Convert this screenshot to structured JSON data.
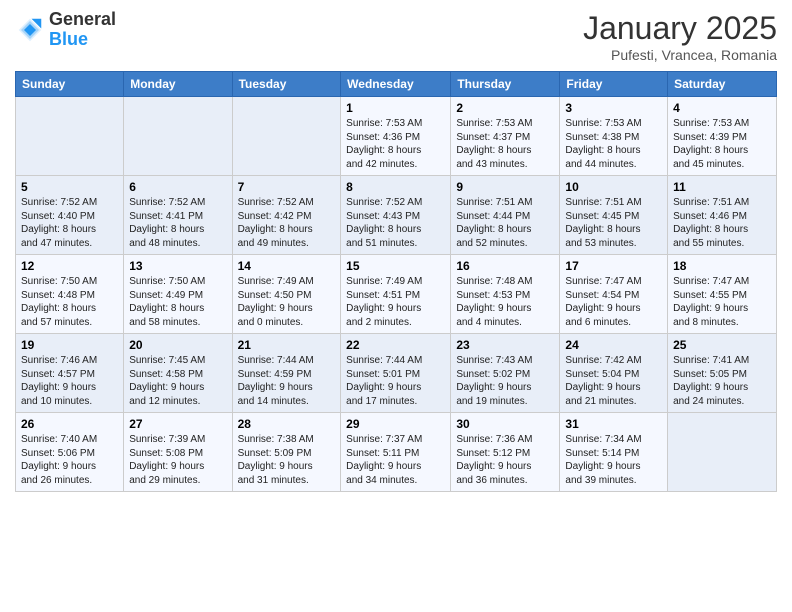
{
  "header": {
    "logo_general": "General",
    "logo_blue": "Blue",
    "title": "January 2025",
    "location": "Pufesti, Vrancea, Romania"
  },
  "days_of_week": [
    "Sunday",
    "Monday",
    "Tuesday",
    "Wednesday",
    "Thursday",
    "Friday",
    "Saturday"
  ],
  "weeks": [
    [
      {
        "day": "",
        "info": ""
      },
      {
        "day": "",
        "info": ""
      },
      {
        "day": "",
        "info": ""
      },
      {
        "day": "1",
        "info": "Sunrise: 7:53 AM\nSunset: 4:36 PM\nDaylight: 8 hours\nand 42 minutes."
      },
      {
        "day": "2",
        "info": "Sunrise: 7:53 AM\nSunset: 4:37 PM\nDaylight: 8 hours\nand 43 minutes."
      },
      {
        "day": "3",
        "info": "Sunrise: 7:53 AM\nSunset: 4:38 PM\nDaylight: 8 hours\nand 44 minutes."
      },
      {
        "day": "4",
        "info": "Sunrise: 7:53 AM\nSunset: 4:39 PM\nDaylight: 8 hours\nand 45 minutes."
      }
    ],
    [
      {
        "day": "5",
        "info": "Sunrise: 7:52 AM\nSunset: 4:40 PM\nDaylight: 8 hours\nand 47 minutes."
      },
      {
        "day": "6",
        "info": "Sunrise: 7:52 AM\nSunset: 4:41 PM\nDaylight: 8 hours\nand 48 minutes."
      },
      {
        "day": "7",
        "info": "Sunrise: 7:52 AM\nSunset: 4:42 PM\nDaylight: 8 hours\nand 49 minutes."
      },
      {
        "day": "8",
        "info": "Sunrise: 7:52 AM\nSunset: 4:43 PM\nDaylight: 8 hours\nand 51 minutes."
      },
      {
        "day": "9",
        "info": "Sunrise: 7:51 AM\nSunset: 4:44 PM\nDaylight: 8 hours\nand 52 minutes."
      },
      {
        "day": "10",
        "info": "Sunrise: 7:51 AM\nSunset: 4:45 PM\nDaylight: 8 hours\nand 53 minutes."
      },
      {
        "day": "11",
        "info": "Sunrise: 7:51 AM\nSunset: 4:46 PM\nDaylight: 8 hours\nand 55 minutes."
      }
    ],
    [
      {
        "day": "12",
        "info": "Sunrise: 7:50 AM\nSunset: 4:48 PM\nDaylight: 8 hours\nand 57 minutes."
      },
      {
        "day": "13",
        "info": "Sunrise: 7:50 AM\nSunset: 4:49 PM\nDaylight: 8 hours\nand 58 minutes."
      },
      {
        "day": "14",
        "info": "Sunrise: 7:49 AM\nSunset: 4:50 PM\nDaylight: 9 hours\nand 0 minutes."
      },
      {
        "day": "15",
        "info": "Sunrise: 7:49 AM\nSunset: 4:51 PM\nDaylight: 9 hours\nand 2 minutes."
      },
      {
        "day": "16",
        "info": "Sunrise: 7:48 AM\nSunset: 4:53 PM\nDaylight: 9 hours\nand 4 minutes."
      },
      {
        "day": "17",
        "info": "Sunrise: 7:47 AM\nSunset: 4:54 PM\nDaylight: 9 hours\nand 6 minutes."
      },
      {
        "day": "18",
        "info": "Sunrise: 7:47 AM\nSunset: 4:55 PM\nDaylight: 9 hours\nand 8 minutes."
      }
    ],
    [
      {
        "day": "19",
        "info": "Sunrise: 7:46 AM\nSunset: 4:57 PM\nDaylight: 9 hours\nand 10 minutes."
      },
      {
        "day": "20",
        "info": "Sunrise: 7:45 AM\nSunset: 4:58 PM\nDaylight: 9 hours\nand 12 minutes."
      },
      {
        "day": "21",
        "info": "Sunrise: 7:44 AM\nSunset: 4:59 PM\nDaylight: 9 hours\nand 14 minutes."
      },
      {
        "day": "22",
        "info": "Sunrise: 7:44 AM\nSunset: 5:01 PM\nDaylight: 9 hours\nand 17 minutes."
      },
      {
        "day": "23",
        "info": "Sunrise: 7:43 AM\nSunset: 5:02 PM\nDaylight: 9 hours\nand 19 minutes."
      },
      {
        "day": "24",
        "info": "Sunrise: 7:42 AM\nSunset: 5:04 PM\nDaylight: 9 hours\nand 21 minutes."
      },
      {
        "day": "25",
        "info": "Sunrise: 7:41 AM\nSunset: 5:05 PM\nDaylight: 9 hours\nand 24 minutes."
      }
    ],
    [
      {
        "day": "26",
        "info": "Sunrise: 7:40 AM\nSunset: 5:06 PM\nDaylight: 9 hours\nand 26 minutes."
      },
      {
        "day": "27",
        "info": "Sunrise: 7:39 AM\nSunset: 5:08 PM\nDaylight: 9 hours\nand 29 minutes."
      },
      {
        "day": "28",
        "info": "Sunrise: 7:38 AM\nSunset: 5:09 PM\nDaylight: 9 hours\nand 31 minutes."
      },
      {
        "day": "29",
        "info": "Sunrise: 7:37 AM\nSunset: 5:11 PM\nDaylight: 9 hours\nand 34 minutes."
      },
      {
        "day": "30",
        "info": "Sunrise: 7:36 AM\nSunset: 5:12 PM\nDaylight: 9 hours\nand 36 minutes."
      },
      {
        "day": "31",
        "info": "Sunrise: 7:34 AM\nSunset: 5:14 PM\nDaylight: 9 hours\nand 39 minutes."
      },
      {
        "day": "",
        "info": ""
      }
    ]
  ]
}
